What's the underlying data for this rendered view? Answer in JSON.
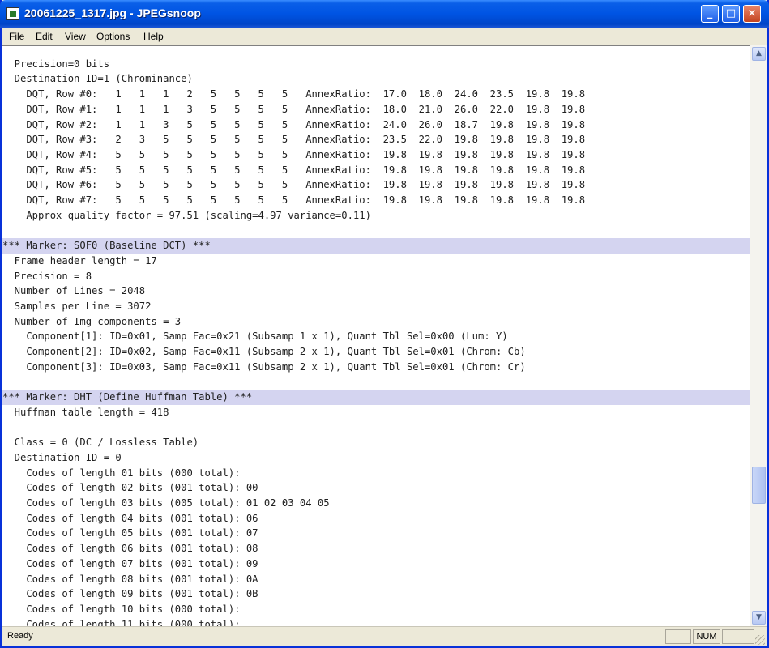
{
  "window": {
    "title": "20061225_1317.jpg - JPEGsnoop"
  },
  "titlebar_buttons": {
    "minimize": "_",
    "maximize": "□",
    "close": "×"
  },
  "menu": [
    "File",
    "Edit",
    "View",
    "Options",
    "Help"
  ],
  "lines": [
    {
      "text": "  ----",
      "marker": false
    },
    {
      "text": "  Precision=0 bits",
      "marker": false
    },
    {
      "text": "  Destination ID=1 (Chrominance)",
      "marker": false
    },
    {
      "text": "    DQT, Row #0:   1   1   1   2   5   5   5   5   AnnexRatio:  17.0  18.0  24.0  23.5  19.8  19.8",
      "marker": false
    },
    {
      "text": "    DQT, Row #1:   1   1   1   3   5   5   5   5   AnnexRatio:  18.0  21.0  26.0  22.0  19.8  19.8",
      "marker": false
    },
    {
      "text": "    DQT, Row #2:   1   1   3   5   5   5   5   5   AnnexRatio:  24.0  26.0  18.7  19.8  19.8  19.8",
      "marker": false
    },
    {
      "text": "    DQT, Row #3:   2   3   5   5   5   5   5   5   AnnexRatio:  23.5  22.0  19.8  19.8  19.8  19.8",
      "marker": false
    },
    {
      "text": "    DQT, Row #4:   5   5   5   5   5   5   5   5   AnnexRatio:  19.8  19.8  19.8  19.8  19.8  19.8",
      "marker": false
    },
    {
      "text": "    DQT, Row #5:   5   5   5   5   5   5   5   5   AnnexRatio:  19.8  19.8  19.8  19.8  19.8  19.8",
      "marker": false
    },
    {
      "text": "    DQT, Row #6:   5   5   5   5   5   5   5   5   AnnexRatio:  19.8  19.8  19.8  19.8  19.8  19.8",
      "marker": false
    },
    {
      "text": "    DQT, Row #7:   5   5   5   5   5   5   5   5   AnnexRatio:  19.8  19.8  19.8  19.8  19.8  19.8",
      "marker": false
    },
    {
      "text": "    Approx quality factor = 97.51 (scaling=4.97 variance=0.11)",
      "marker": false
    },
    {
      "text": "",
      "marker": false
    },
    {
      "text": "*** Marker: SOF0 (Baseline DCT) ***",
      "marker": true
    },
    {
      "text": "  Frame header length = 17",
      "marker": false
    },
    {
      "text": "  Precision = 8",
      "marker": false
    },
    {
      "text": "  Number of Lines = 2048",
      "marker": false
    },
    {
      "text": "  Samples per Line = 3072",
      "marker": false
    },
    {
      "text": "  Number of Img components = 3",
      "marker": false
    },
    {
      "text": "    Component[1]: ID=0x01, Samp Fac=0x21 (Subsamp 1 x 1), Quant Tbl Sel=0x00 (Lum: Y)",
      "marker": false
    },
    {
      "text": "    Component[2]: ID=0x02, Samp Fac=0x11 (Subsamp 2 x 1), Quant Tbl Sel=0x01 (Chrom: Cb)",
      "marker": false
    },
    {
      "text": "    Component[3]: ID=0x03, Samp Fac=0x11 (Subsamp 2 x 1), Quant Tbl Sel=0x01 (Chrom: Cr)",
      "marker": false
    },
    {
      "text": "",
      "marker": false
    },
    {
      "text": "*** Marker: DHT (Define Huffman Table) ***",
      "marker": true
    },
    {
      "text": "  Huffman table length = 418",
      "marker": false
    },
    {
      "text": "  ----",
      "marker": false
    },
    {
      "text": "  Class = 0 (DC / Lossless Table)",
      "marker": false
    },
    {
      "text": "  Destination ID = 0",
      "marker": false
    },
    {
      "text": "    Codes of length 01 bits (000 total):",
      "marker": false
    },
    {
      "text": "    Codes of length 02 bits (001 total): 00",
      "marker": false
    },
    {
      "text": "    Codes of length 03 bits (005 total): 01 02 03 04 05",
      "marker": false
    },
    {
      "text": "    Codes of length 04 bits (001 total): 06",
      "marker": false
    },
    {
      "text": "    Codes of length 05 bits (001 total): 07",
      "marker": false
    },
    {
      "text": "    Codes of length 06 bits (001 total): 08",
      "marker": false
    },
    {
      "text": "    Codes of length 07 bits (001 total): 09",
      "marker": false
    },
    {
      "text": "    Codes of length 08 bits (001 total): 0A",
      "marker": false
    },
    {
      "text": "    Codes of length 09 bits (001 total): 0B",
      "marker": false
    },
    {
      "text": "    Codes of length 10 bits (000 total):",
      "marker": false
    },
    {
      "text": "    Codes of length 11 bits (000 total):",
      "marker": false
    }
  ],
  "statusbar": {
    "text": "Ready",
    "num": "NUM"
  },
  "scrollbar": {
    "up_arrow": "▲",
    "down_arrow": "▼"
  }
}
